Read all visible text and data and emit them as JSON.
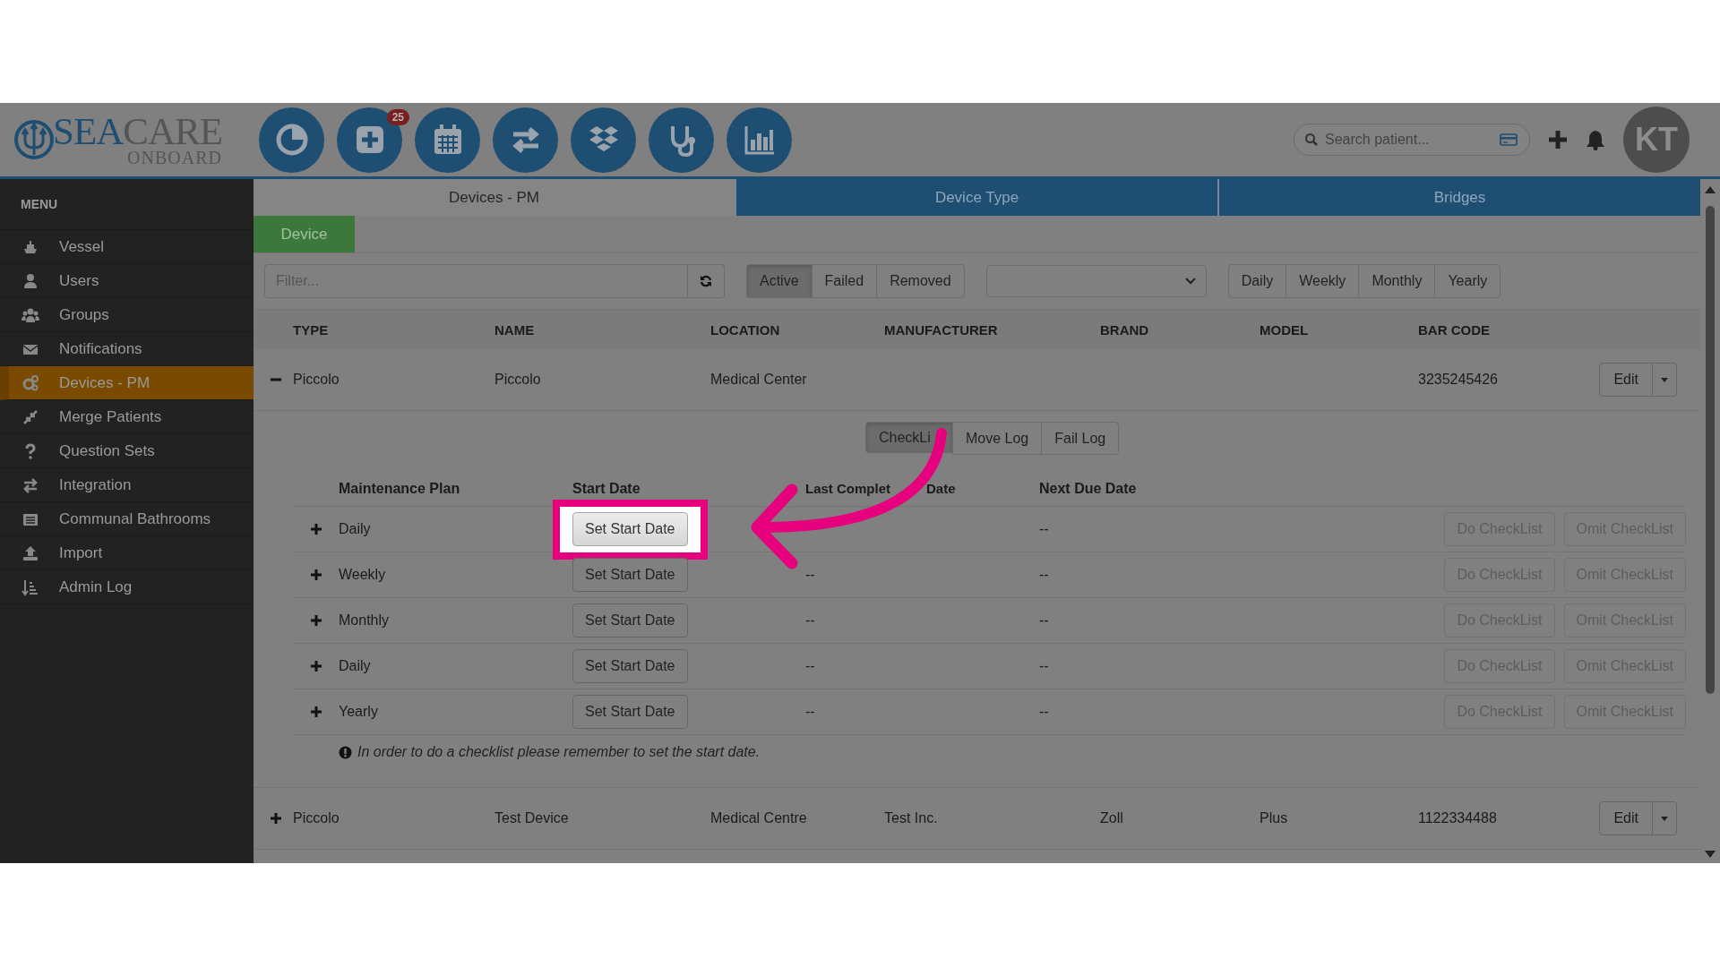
{
  "logo": {
    "brand_a": "SEA",
    "brand_b": "CARE",
    "tagline": "ONBOARD"
  },
  "toolbar": {
    "badge": "25",
    "search": {
      "placeholder": "Search patient..."
    },
    "avatar": "KT"
  },
  "sidebar": {
    "title": "MENU",
    "items": [
      {
        "label": "Vessel",
        "selected": false
      },
      {
        "label": "Users",
        "selected": false
      },
      {
        "label": "Groups",
        "selected": false
      },
      {
        "label": "Notifications",
        "selected": false
      },
      {
        "label": "Devices - PM",
        "selected": true
      },
      {
        "label": "Merge Patients",
        "selected": false
      },
      {
        "label": "Question Sets",
        "selected": false
      },
      {
        "label": "Integration",
        "selected": false
      },
      {
        "label": "Communal Bathrooms",
        "selected": false
      },
      {
        "label": "Import",
        "selected": false
      },
      {
        "label": "Admin Log",
        "selected": false
      }
    ]
  },
  "tabs": [
    {
      "label": "Devices - PM",
      "selected": true
    },
    {
      "label": "Device Type",
      "selected": false
    },
    {
      "label": "Bridges",
      "selected": false
    }
  ],
  "subtab": "Device",
  "filter": {
    "placeholder": "Filter..."
  },
  "status_filter": [
    {
      "label": "Active",
      "selected": true
    },
    {
      "label": "Failed",
      "selected": false
    },
    {
      "label": "Removed",
      "selected": false
    }
  ],
  "period_filter": [
    {
      "label": "Daily",
      "selected": false
    },
    {
      "label": "Weekly",
      "selected": false
    },
    {
      "label": "Monthly",
      "selected": false
    },
    {
      "label": "Yearly",
      "selected": false
    }
  ],
  "table": {
    "columns": [
      "TYPE",
      "NAME",
      "LOCATION",
      "MANUFACTURER",
      "BRAND",
      "MODEL",
      "BAR CODE"
    ],
    "rows": [
      {
        "expanded": true,
        "cells": [
          "Piccolo",
          "Piccolo",
          "Medical Center",
          "",
          "",
          "",
          "3235245426"
        ],
        "edit": "Edit"
      },
      {
        "expanded": false,
        "cells": [
          "Piccolo",
          "Test Device",
          "Medical Centre",
          "Test Inc.",
          "Zoll",
          "Plus",
          "1122334488"
        ],
        "edit": "Edit"
      }
    ]
  },
  "detail": {
    "tabs": [
      {
        "label": "CheckLi",
        "selected": true
      },
      {
        "label": "Move Log",
        "selected": false
      },
      {
        "label": "Fail Log",
        "selected": false
      }
    ],
    "columns": [
      "Maintenance Plan",
      "Start Date",
      "Last Complet",
      "Date",
      "Next Due Date"
    ],
    "plans": [
      {
        "name": "Daily",
        "highlighted": true,
        "start_button": "Set Start Date",
        "next": "--",
        "do_button": "Do CheckList",
        "omit_button": "Omit CheckList",
        "disabled": true
      },
      {
        "name": "Weekly",
        "highlighted": false,
        "start_button": "Set Start Date",
        "last": "--",
        "next": "--",
        "do_button": "Do CheckList",
        "omit_button": "Omit CheckList",
        "disabled": true
      },
      {
        "name": "Monthly",
        "highlighted": false,
        "start_button": "Set Start Date",
        "last": "--",
        "next": "--",
        "do_button": "Do CheckList",
        "omit_button": "Omit CheckList",
        "disabled": true
      },
      {
        "name": "Daily",
        "highlighted": false,
        "start_button": "Set Start Date",
        "last": "--",
        "next": "--",
        "do_button": "Do CheckList",
        "omit_button": "Omit CheckList",
        "disabled": true
      },
      {
        "name": "Yearly",
        "highlighted": false,
        "start_button": "Set Start Date",
        "last": "--",
        "next": "--",
        "do_button": "Do CheckList",
        "omit_button": "Omit CheckList",
        "disabled": true
      }
    ],
    "note": "In order to do a checklist please remember to set the start date."
  }
}
